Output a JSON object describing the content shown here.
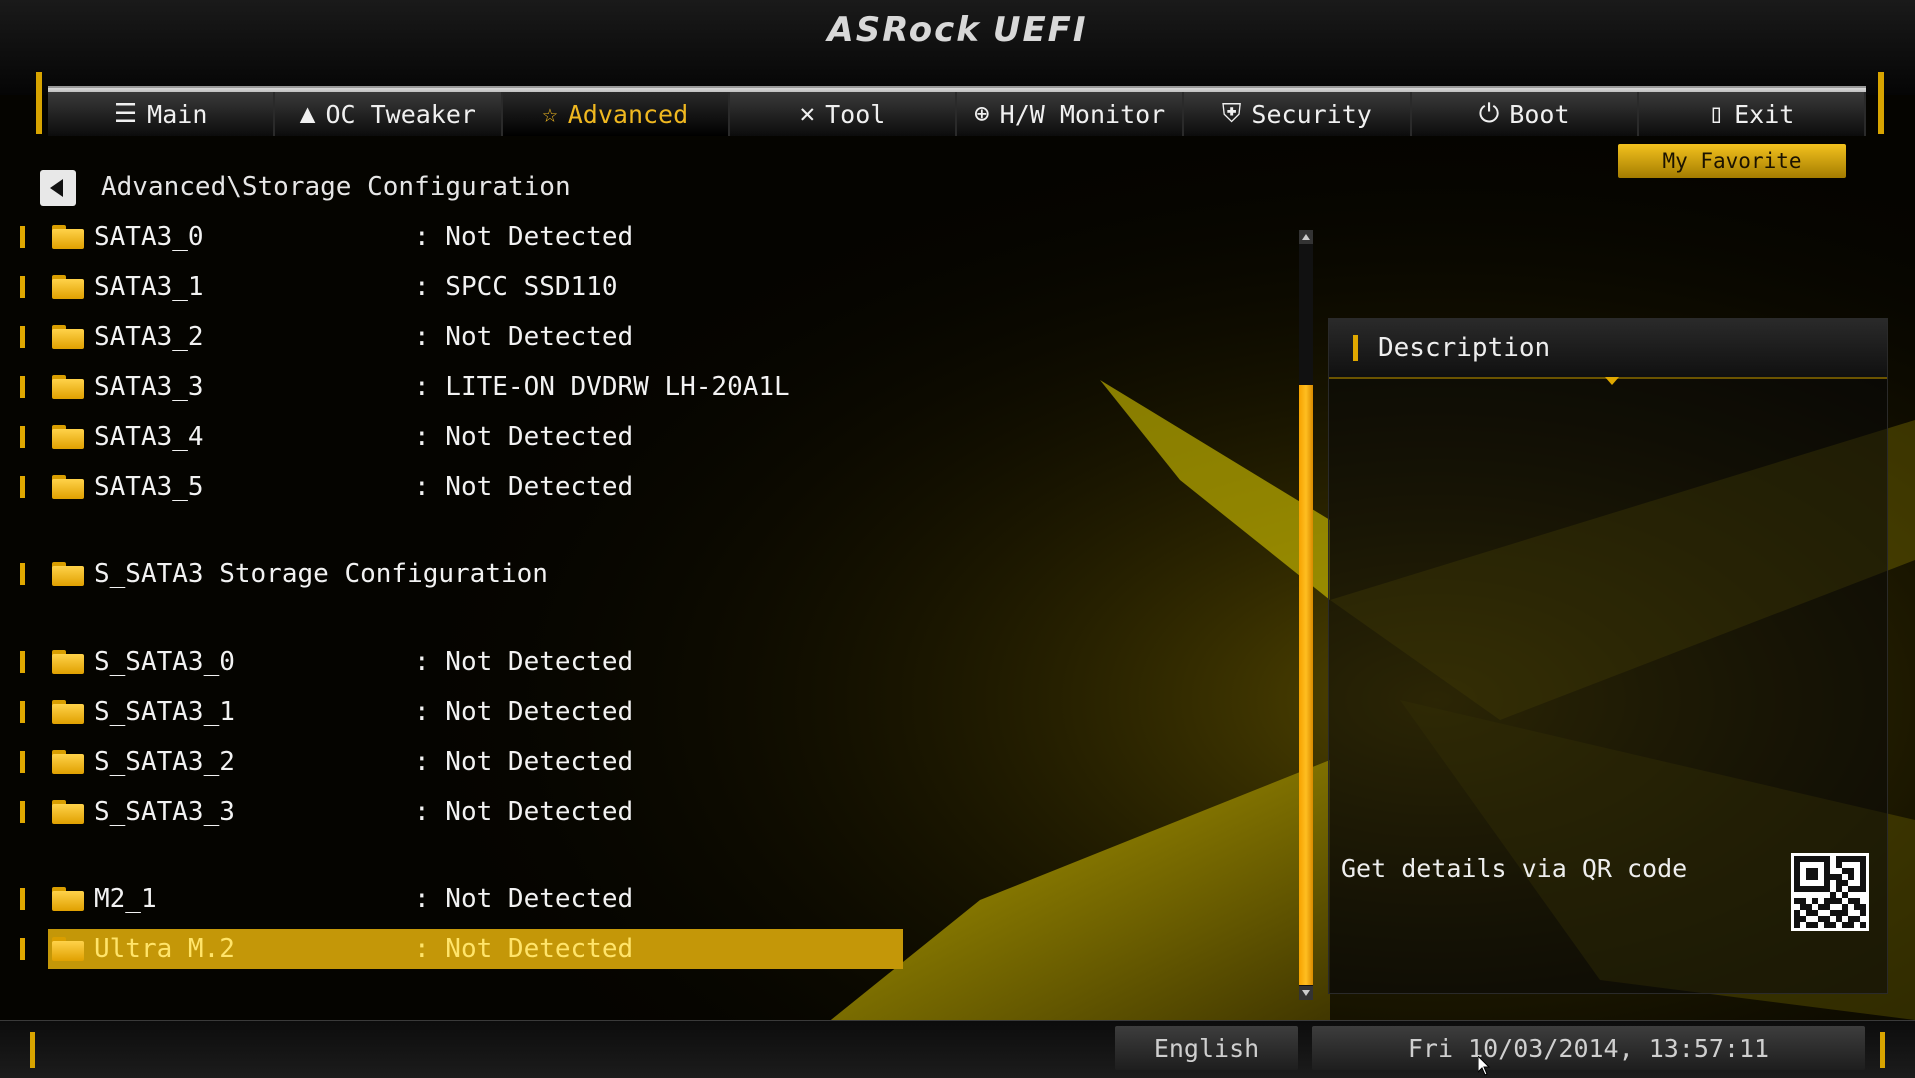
{
  "header": {
    "brand": "ASRock",
    "product": "UEFI"
  },
  "tabs": [
    {
      "label": "Main",
      "icon": "list-icon"
    },
    {
      "label": "OC Tweaker",
      "icon": "rocket-icon"
    },
    {
      "label": "Advanced",
      "icon": "star-icon",
      "active": true
    },
    {
      "label": "Tool",
      "icon": "tools-icon"
    },
    {
      "label": "H/W Monitor",
      "icon": "crosshair-icon"
    },
    {
      "label": "Security",
      "icon": "shield-icon"
    },
    {
      "label": "Boot",
      "icon": "power-icon"
    },
    {
      "label": "Exit",
      "icon": "exit-door-icon"
    }
  ],
  "favorite": {
    "label": "My Favorite"
  },
  "breadcrumb": "Advanced\\Storage Configuration",
  "rows": [
    {
      "label": "SATA3_0",
      "value": ": Not Detected"
    },
    {
      "label": "SATA3_1",
      "value": ": SPCC SSD110"
    },
    {
      "label": "SATA3_2",
      "value": ": Not Detected"
    },
    {
      "label": "SATA3_3",
      "value": ": LITE-ON DVDRW LH-20A1L"
    },
    {
      "label": "SATA3_4",
      "value": ": Not Detected"
    },
    {
      "label": "SATA3_5",
      "value": ": Not Detected"
    },
    {
      "label": "S_SATA3 Storage Configuration",
      "value": ""
    },
    {
      "label": "S_SATA3_0",
      "value": ": Not Detected"
    },
    {
      "label": "S_SATA3_1",
      "value": ": Not Detected"
    },
    {
      "label": "S_SATA3_2",
      "value": ": Not Detected"
    },
    {
      "label": "S_SATA3_3",
      "value": ": Not Detected"
    },
    {
      "label": "M2_1",
      "value": ": Not Detected"
    },
    {
      "label": "Ultra M.2",
      "value": ": Not Detected",
      "selected": true
    }
  ],
  "description": {
    "title": "Description",
    "qr_text": "Get details via QR code"
  },
  "footer": {
    "language": "English",
    "datetime": "Fri 10/03/2014, 13:57:11"
  },
  "colors": {
    "accent": "#e0a800",
    "selected": "#c49708",
    "scroll_thumb": "#ffb000"
  }
}
